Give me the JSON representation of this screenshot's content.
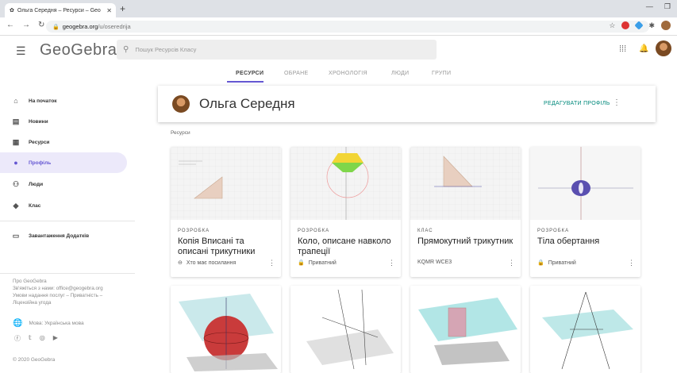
{
  "browser": {
    "tab_title": "Ольга Середня – Ресурси – Geo",
    "url_host": "geogebra.org",
    "url_path": "/u/oseredrija"
  },
  "app": {
    "logo": "GeoGebra",
    "search_placeholder": "Пошук Ресурсів Класу"
  },
  "tabs": [
    "РЕСУРСИ",
    "ОБРАНЕ",
    "ХРОНОЛОГІЯ",
    "ЛЮДИ",
    "ГРУПИ"
  ],
  "sidebar": {
    "items": [
      {
        "label": "На початок",
        "icon": "home-icon"
      },
      {
        "label": "Новини",
        "icon": "news-icon"
      },
      {
        "label": "Ресурси",
        "icon": "resources-icon"
      },
      {
        "label": "Профіль",
        "icon": "profile-icon"
      },
      {
        "label": "Люди",
        "icon": "people-icon"
      },
      {
        "label": "Клас",
        "icon": "class-icon"
      }
    ],
    "download_label": "Завантаження Додатків",
    "footer_lines": [
      "Про GeoGebra",
      "Зв'яжіться з нами: office@geogebra.org",
      "Умови надання послуг – Приватність –",
      "Ліцензійна угода"
    ],
    "language": "Мова: Українська мова",
    "copyright": "© 2020 GeoGebra"
  },
  "profile": {
    "name": "Ольга Середня",
    "edit_label": "РЕДАГУВАТИ ПРОФІЛЬ"
  },
  "resources_label": "Ресурси",
  "cards": [
    {
      "type": "РОЗРОБКА",
      "title": "Копія Вписані та описані трикутники",
      "info": "Хто має посилання",
      "info_icon": "link-icon"
    },
    {
      "type": "РОЗРОБКА",
      "title": "Коло, описане навколо трапеції",
      "info": "Приватний",
      "info_icon": "lock-icon"
    },
    {
      "type": "КЛАС",
      "title": "Прямокутний трикутник",
      "info": "KQMR WCE3",
      "info_icon": ""
    },
    {
      "type": "РОЗРОБКА",
      "title": "Тіла обертання",
      "info": "Приватний",
      "info_icon": "lock-icon"
    }
  ],
  "colors": {
    "accent": "#6557d2",
    "edit_link": "#00897b"
  }
}
